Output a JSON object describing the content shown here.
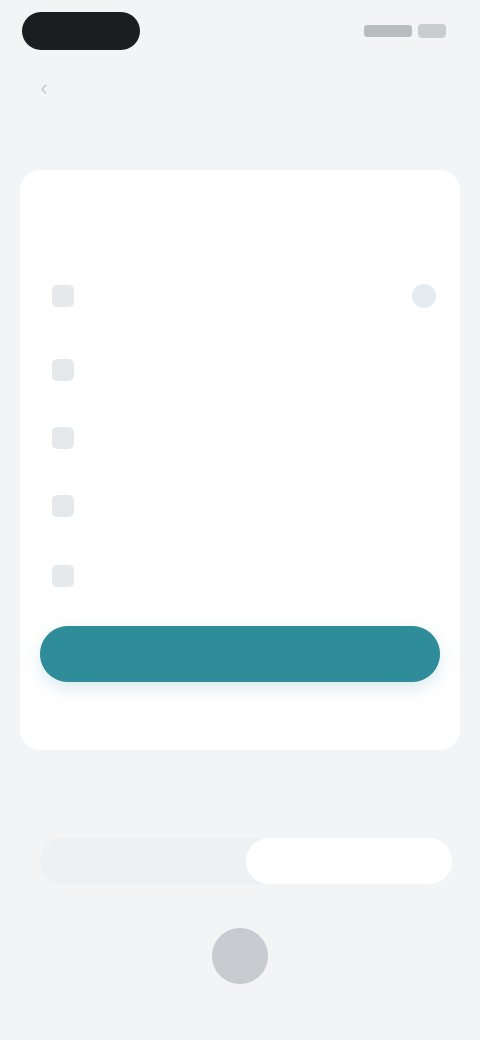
{
  "header": {
    "title": ""
  },
  "card": {
    "label": "",
    "subtitle": "",
    "options": [
      {
        "label": "",
        "selected": true
      },
      {
        "label": "",
        "selected": false
      },
      {
        "label": "",
        "selected": false
      },
      {
        "label": "",
        "selected": false
      },
      {
        "label": "",
        "selected": false
      }
    ],
    "continue_label": "",
    "secondary_label": ""
  },
  "bottom": {
    "section_title": "",
    "segments": [
      {
        "label": "",
        "active": false
      },
      {
        "label": "",
        "active": true
      }
    ],
    "avatar_initial": ""
  },
  "colors": {
    "accent": "#2e8d99",
    "highlight": "#f0b79b",
    "background": "#f2f4f6"
  }
}
